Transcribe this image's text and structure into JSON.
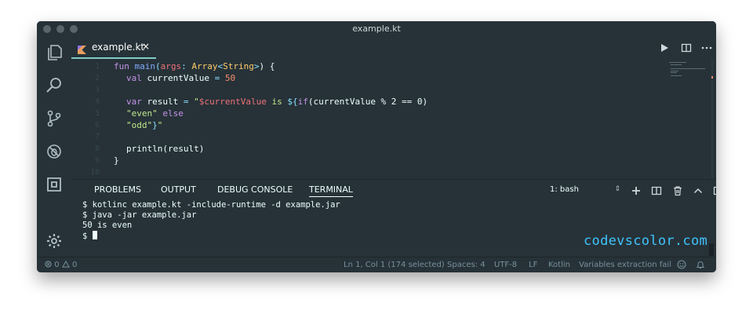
{
  "window": {
    "title": "example.kt"
  },
  "tab": {
    "name": "example.kt",
    "close": "×"
  },
  "editor": {
    "lines": [
      {
        "n": "1"
      },
      {
        "n": "2"
      },
      {
        "n": "3"
      },
      {
        "n": "4"
      },
      {
        "n": "5"
      },
      {
        "n": "6"
      },
      {
        "n": "7"
      },
      {
        "n": "8"
      },
      {
        "n": "9"
      },
      {
        "n": "10"
      }
    ],
    "code": {
      "l1": {
        "fun": "fun",
        "name": "main",
        "open": "(",
        "arg": "args",
        "colon": ": ",
        "type1": "Array",
        "lt": "<",
        "type2": "String",
        "gt": ">",
        "close": ") {"
      },
      "l2": {
        "kw": "val",
        "name": "currentValue",
        "eq": " = ",
        "num": "50"
      },
      "l4": {
        "kw": "var",
        "name": "result",
        "eq": " = ",
        "s1": "\"",
        "tmpl": "$currentValue",
        "s2": " is ",
        "dollar": "${",
        "iff": "if",
        "expr": "(currentValue % 2 == 0)"
      },
      "l5": {
        "s": "\"even\"",
        "kw": "else"
      },
      "l6": {
        "s1": "\"odd\"",
        "close": "}",
        "s2": "\""
      },
      "l8": {
        "text": "println(result)"
      },
      "l9": {
        "text": "}"
      }
    }
  },
  "panel": {
    "tabs": [
      "PROBLEMS",
      "OUTPUT",
      "DEBUG CONSOLE",
      "TERMINAL"
    ],
    "active_tab": "TERMINAL",
    "shell": "1: bash",
    "shell_arrows": "⇕",
    "terminal_lines": [
      "$ kotlinc example.kt -include-runtime -d example.jar",
      "$ java -jar example.jar",
      "50 is even",
      "$ "
    ]
  },
  "watermark": "codevscolor.com",
  "status": {
    "errors": "0",
    "warnings": "0",
    "position": "Ln 1, Col 1 (174 selected)",
    "spaces": "Spaces: 4",
    "encoding": "UTF-8",
    "eol": "LF",
    "language": "Kotlin",
    "extension_msg": "Variables extraction fail"
  },
  "colors": {
    "background": "#263238",
    "accent": "#80cbc4",
    "keyword": "#c792ea",
    "function": "#82aaff",
    "string": "#c3e88d",
    "number": "#f78c6c",
    "watermark": "#40c4ff"
  }
}
